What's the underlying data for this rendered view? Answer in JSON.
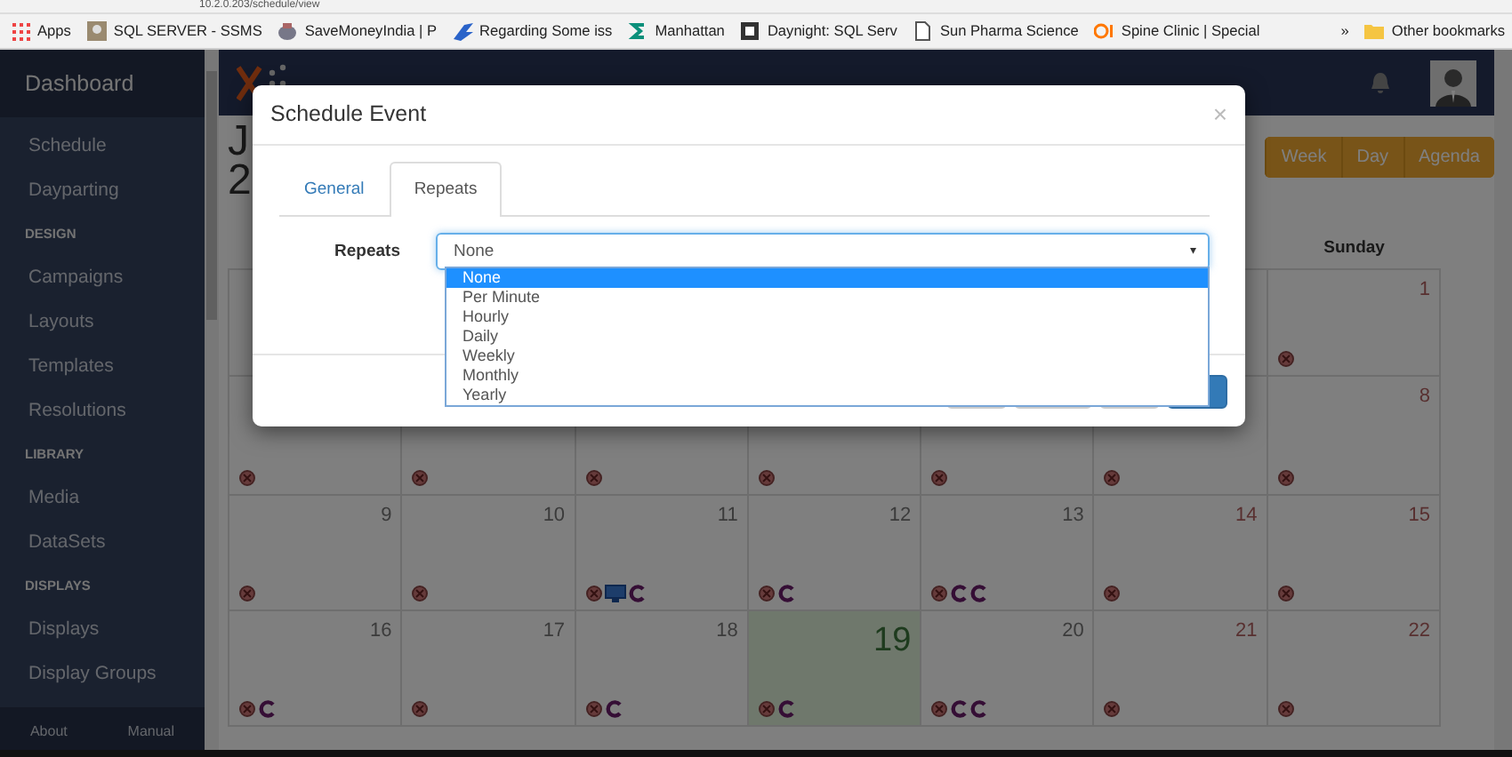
{
  "browser": {
    "address": "10.2.0.203/schedule/view",
    "bookmarks": [
      {
        "label": "Apps",
        "kind": "apps"
      },
      {
        "label": "SQL SERVER - SSMS",
        "kind": "photo"
      },
      {
        "label": "SaveMoneyIndia | P",
        "kind": "piggy"
      },
      {
        "label": "Regarding Some iss",
        "kind": "wing"
      },
      {
        "label": "Manhattan",
        "kind": "s"
      },
      {
        "label": "Daynight: SQL Serv",
        "kind": "square"
      },
      {
        "label": "Sun Pharma Science",
        "kind": "page"
      },
      {
        "label": "Spine Clinic | Special",
        "kind": "qi"
      }
    ],
    "more": "»",
    "other": "Other bookmarks"
  },
  "sidebar": {
    "title": "Dashboard",
    "items": [
      {
        "kind": "link",
        "label": "Schedule"
      },
      {
        "kind": "link",
        "label": "Dayparting"
      },
      {
        "kind": "heading",
        "label": "DESIGN"
      },
      {
        "kind": "link",
        "label": "Campaigns"
      },
      {
        "kind": "link",
        "label": "Layouts"
      },
      {
        "kind": "link",
        "label": "Templates"
      },
      {
        "kind": "link",
        "label": "Resolutions"
      },
      {
        "kind": "heading",
        "label": "LIBRARY"
      },
      {
        "kind": "link",
        "label": "Media"
      },
      {
        "kind": "link",
        "label": "DataSets"
      },
      {
        "kind": "heading",
        "label": "DISPLAYS"
      },
      {
        "kind": "link",
        "label": "Displays"
      },
      {
        "kind": "link",
        "label": "Display Groups"
      }
    ],
    "footer": [
      "About",
      "Manual"
    ]
  },
  "page": {
    "title_lines": [
      "J",
      "2"
    ],
    "views": [
      "Week",
      "Day",
      "Agenda"
    ],
    "weekdays": [
      "Sunday"
    ]
  },
  "calendar": {
    "rows": [
      {
        "cells": [
          {},
          {},
          {},
          {},
          {},
          {},
          {
            "day": "1",
            "weekend": true,
            "events": [
              {
                "kind": "dot"
              }
            ]
          }
        ]
      },
      {
        "cells": [
          {
            "events": [
              {
                "kind": "dot"
              }
            ]
          },
          {
            "events": [
              {
                "kind": "dot"
              }
            ]
          },
          {
            "events": [
              {
                "kind": "dot"
              }
            ]
          },
          {
            "events": [
              {
                "kind": "dot"
              }
            ]
          },
          {
            "events": [
              {
                "kind": "dot"
              }
            ]
          },
          {
            "events": [
              {
                "kind": "dot"
              }
            ]
          },
          {
            "day": "8",
            "weekend": true,
            "events": [
              {
                "kind": "dot"
              }
            ]
          }
        ]
      },
      {
        "cells": [
          {
            "day": "9",
            "events": [
              {
                "kind": "dot"
              }
            ]
          },
          {
            "day": "10",
            "events": [
              {
                "kind": "dot"
              }
            ]
          },
          {
            "day": "11",
            "events": [
              {
                "kind": "dot"
              },
              {
                "kind": "display"
              },
              {
                "kind": "campaign"
              }
            ]
          },
          {
            "day": "12",
            "events": [
              {
                "kind": "dot"
              },
              {
                "kind": "campaign"
              }
            ]
          },
          {
            "day": "13",
            "events": [
              {
                "kind": "dot"
              },
              {
                "kind": "campaign"
              },
              {
                "kind": "campaign"
              }
            ]
          },
          {
            "day": "14",
            "weekend": true,
            "events": [
              {
                "kind": "dot"
              }
            ]
          },
          {
            "day": "15",
            "weekend": true,
            "events": [
              {
                "kind": "dot"
              }
            ]
          }
        ]
      },
      {
        "cells": [
          {
            "day": "16",
            "events": [
              {
                "kind": "dot"
              },
              {
                "kind": "campaign"
              }
            ]
          },
          {
            "day": "17",
            "events": [
              {
                "kind": "dot"
              }
            ]
          },
          {
            "day": "18",
            "events": [
              {
                "kind": "dot"
              },
              {
                "kind": "campaign"
              }
            ]
          },
          {
            "day": "19",
            "today": true,
            "events": [
              {
                "kind": "dot"
              },
              {
                "kind": "campaign"
              }
            ]
          },
          {
            "day": "20",
            "events": [
              {
                "kind": "dot"
              },
              {
                "kind": "campaign"
              },
              {
                "kind": "campaign"
              }
            ]
          },
          {
            "day": "21",
            "weekend": true,
            "events": [
              {
                "kind": "dot"
              }
            ]
          },
          {
            "day": "22",
            "weekend": true,
            "events": [
              {
                "kind": "dot"
              }
            ]
          }
        ]
      }
    ]
  },
  "modal": {
    "title": "Schedule Event",
    "close": "×",
    "tabs": [
      {
        "label": "General",
        "selected": false
      },
      {
        "label": "Repeats",
        "selected": true
      }
    ],
    "field": {
      "label": "Repeats",
      "value": "None",
      "caret": "▾",
      "options": [
        {
          "label": "None",
          "selected": true
        },
        {
          "label": "Per Minute",
          "selected": false
        },
        {
          "label": "Hourly",
          "selected": false
        },
        {
          "label": "Daily",
          "selected": false
        },
        {
          "label": "Weekly",
          "selected": false
        },
        {
          "label": "Monthly",
          "selected": false
        },
        {
          "label": "Yearly",
          "selected": false
        }
      ]
    },
    "footer_buttons": [
      {
        "kind": "default"
      },
      {
        "kind": "default"
      },
      {
        "kind": "default"
      },
      {
        "kind": "primary"
      }
    ]
  }
}
